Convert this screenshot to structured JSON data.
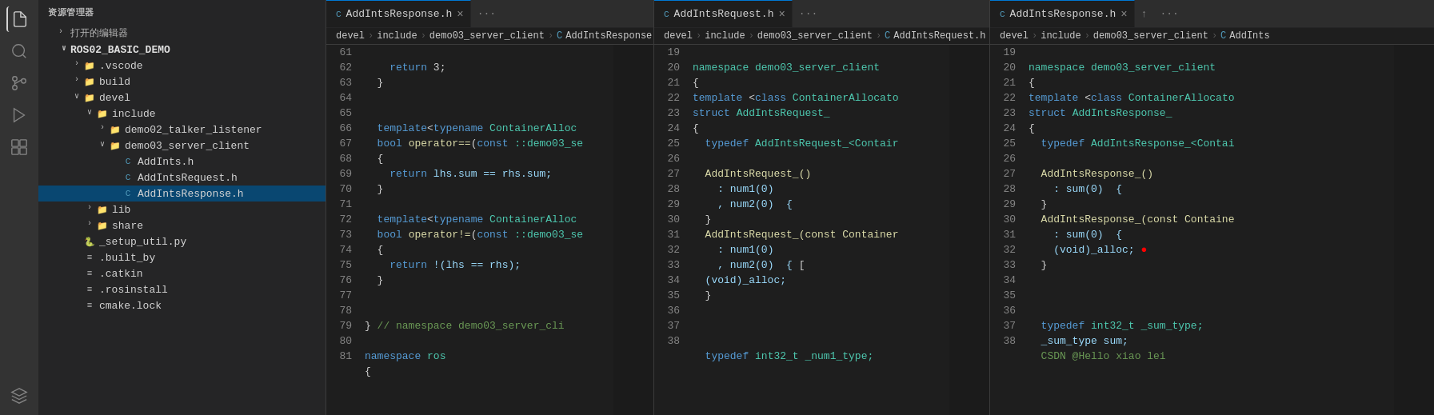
{
  "activityBar": {
    "icons": [
      {
        "name": "files-icon",
        "label": "Explorer",
        "active": true,
        "symbol": "⬜"
      },
      {
        "name": "search-icon",
        "label": "Search",
        "active": false,
        "symbol": "🔍"
      },
      {
        "name": "source-control-icon",
        "label": "Source Control",
        "active": false,
        "symbol": "⎇"
      },
      {
        "name": "run-icon",
        "label": "Run",
        "active": false,
        "symbol": "▷"
      },
      {
        "name": "extensions-icon",
        "label": "Extensions",
        "active": false,
        "symbol": "⊞"
      },
      {
        "name": "remote-icon",
        "label": "Remote",
        "active": false,
        "symbol": "⬡"
      }
    ]
  },
  "sidebar": {
    "header": "资源管理器",
    "openEditors": "打开的编辑器",
    "root": "ROS02_BASIC_DEMO",
    "items": [
      {
        "id": "vscode",
        "label": ".vscode",
        "type": "folder",
        "indent": 2,
        "collapsed": true
      },
      {
        "id": "build",
        "label": "build",
        "type": "folder",
        "indent": 2,
        "collapsed": true
      },
      {
        "id": "devel",
        "label": "devel",
        "type": "folder",
        "indent": 2,
        "collapsed": false
      },
      {
        "id": "include",
        "label": "include",
        "type": "folder",
        "indent": 3,
        "collapsed": false
      },
      {
        "id": "demo02_talker_listener",
        "label": "demo02_talker_listener",
        "type": "folder",
        "indent": 4,
        "collapsed": true
      },
      {
        "id": "demo03_server_client",
        "label": "demo03_server_client",
        "type": "folder",
        "indent": 4,
        "collapsed": false
      },
      {
        "id": "AddInts.h",
        "label": "AddInts.h",
        "type": "c-file",
        "indent": 5
      },
      {
        "id": "AddIntsRequest.h",
        "label": "AddIntsRequest.h",
        "type": "c-file",
        "indent": 5
      },
      {
        "id": "AddIntsResponse.h",
        "label": "AddIntsResponse.h",
        "type": "c-file",
        "indent": 5,
        "selected": true
      },
      {
        "id": "lib",
        "label": "lib",
        "type": "folder",
        "indent": 3,
        "collapsed": true
      },
      {
        "id": "share",
        "label": "share",
        "type": "folder",
        "indent": 3,
        "collapsed": true
      },
      {
        "id": "_setup_util.py",
        "label": "_setup_util.py",
        "type": "py-file",
        "indent": 2
      },
      {
        "id": ".built_by",
        "label": ".built_by",
        "type": "txt-file",
        "indent": 2
      },
      {
        "id": ".catkin",
        "label": ".catkin",
        "type": "txt-file",
        "indent": 2
      },
      {
        "id": ".rosinstall",
        "label": ".rosinstall",
        "type": "txt-file",
        "indent": 2
      },
      {
        "id": "cmake.lock",
        "label": "cmake.lock",
        "type": "txt-file",
        "indent": 2
      }
    ]
  },
  "panes": [
    {
      "id": "pane1",
      "tabs": [
        {
          "label": "AddIntsResponse.h",
          "active": true,
          "icon": "C",
          "hasClose": true
        },
        {
          "label": "...",
          "isMore": true
        }
      ],
      "breadcrumb": [
        "devel",
        ">",
        "include",
        ">",
        "demo03_server_client",
        ">",
        "C",
        "AddIntsResponse"
      ],
      "startLine": 61,
      "lines": [
        {
          "num": 61,
          "tokens": [
            {
              "t": "    ",
              "c": ""
            },
            {
              "t": "return",
              "c": "kw"
            },
            {
              "t": " 3;",
              "c": ""
            }
          ]
        },
        {
          "num": 62,
          "tokens": [
            {
              "t": "  }",
              "c": ""
            }
          ]
        },
        {
          "num": 63,
          "tokens": []
        },
        {
          "num": 64,
          "tokens": []
        },
        {
          "num": 65,
          "tokens": [
            {
              "t": "  ",
              "c": ""
            },
            {
              "t": "template",
              "c": "kw"
            },
            {
              "t": "<",
              "c": ""
            },
            {
              "t": "typename",
              "c": "kw"
            },
            {
              "t": " ContainerAlloc",
              "c": "type"
            }
          ]
        },
        {
          "num": 66,
          "tokens": [
            {
              "t": "  ",
              "c": ""
            },
            {
              "t": "bool",
              "c": "kw"
            },
            {
              "t": " ",
              "c": ""
            },
            {
              "t": "operator==",
              "c": "fn"
            },
            {
              "t": "(",
              "c": ""
            },
            {
              "t": "const",
              "c": "kw"
            },
            {
              "t": " ::demo03_s",
              "c": "ns"
            }
          ]
        },
        {
          "num": 67,
          "tokens": [
            {
              "t": "  {",
              "c": ""
            }
          ]
        },
        {
          "num": 68,
          "tokens": [
            {
              "t": "    ",
              "c": ""
            },
            {
              "t": "return",
              "c": "kw"
            },
            {
              "t": " lhs.sum == rhs.sum;",
              "c": "var"
            }
          ]
        },
        {
          "num": 69,
          "tokens": [
            {
              "t": "  }",
              "c": ""
            }
          ]
        },
        {
          "num": 70,
          "tokens": []
        },
        {
          "num": 71,
          "tokens": [
            {
              "t": "  ",
              "c": ""
            },
            {
              "t": "template",
              "c": "kw"
            },
            {
              "t": "<",
              "c": ""
            },
            {
              "t": "typename",
              "c": "kw"
            },
            {
              "t": " ContainerAlloc",
              "c": "type"
            }
          ]
        },
        {
          "num": 72,
          "tokens": [
            {
              "t": "  ",
              "c": ""
            },
            {
              "t": "bool",
              "c": "kw"
            },
            {
              "t": " ",
              "c": ""
            },
            {
              "t": "operator!=",
              "c": "fn"
            },
            {
              "t": "(",
              "c": ""
            },
            {
              "t": "const",
              "c": "kw"
            },
            {
              "t": " ::demo03_s",
              "c": "ns"
            }
          ]
        },
        {
          "num": 73,
          "tokens": [
            {
              "t": "  {",
              "c": ""
            }
          ]
        },
        {
          "num": 74,
          "tokens": [
            {
              "t": "    ",
              "c": ""
            },
            {
              "t": "return",
              "c": "kw"
            },
            {
              "t": " !(lhs == rhs);",
              "c": "var"
            }
          ]
        },
        {
          "num": 75,
          "tokens": [
            {
              "t": "  }",
              "c": ""
            }
          ]
        },
        {
          "num": 76,
          "tokens": []
        },
        {
          "num": 77,
          "tokens": []
        },
        {
          "num": 78,
          "tokens": [
            {
              "t": "} ",
              "c": ""
            },
            {
              "t": "// namespace demo03_server_cli",
              "c": "cmt"
            }
          ]
        },
        {
          "num": 79,
          "tokens": []
        },
        {
          "num": 80,
          "tokens": [
            {
              "t": "namespace",
              "c": "kw"
            },
            {
              "t": " ros",
              "c": "ns"
            }
          ]
        },
        {
          "num": 81,
          "tokens": [
            {
              "t": "{",
              "c": ""
            }
          ]
        }
      ]
    },
    {
      "id": "pane2",
      "tabs": [
        {
          "label": "AddIntsRequest.h",
          "active": true,
          "icon": "C",
          "hasClose": true
        },
        {
          "label": "...",
          "isMore": true
        }
      ],
      "breadcrumb": [
        "devel",
        ">",
        "include",
        ">",
        "demo03_server_client",
        ">",
        "C",
        "AddIntsRequest.h"
      ],
      "startLine": 19,
      "lines": [
        {
          "num": 19,
          "tokens": [
            {
              "t": "namespace demo03_server_client",
              "c": "ns"
            }
          ]
        },
        {
          "num": 20,
          "tokens": [
            {
              "t": "{",
              "c": ""
            }
          ]
        },
        {
          "num": 21,
          "tokens": [
            {
              "t": "template",
              "c": "kw"
            },
            {
              "t": " <",
              "c": ""
            },
            {
              "t": "class",
              "c": "kw"
            },
            {
              "t": " ContainerAllocato",
              "c": "type"
            }
          ]
        },
        {
          "num": 22,
          "tokens": [
            {
              "t": "struct",
              "c": "kw"
            },
            {
              "t": " AddIntsRequest_",
              "c": "type"
            }
          ]
        },
        {
          "num": 23,
          "tokens": [
            {
              "t": "{",
              "c": ""
            }
          ]
        },
        {
          "num": 24,
          "tokens": [
            {
              "t": "  ",
              "c": ""
            },
            {
              "t": "typedef",
              "c": "kw"
            },
            {
              "t": " AddIntsRequest_<Contair",
              "c": "type"
            }
          ]
        },
        {
          "num": 25,
          "tokens": []
        },
        {
          "num": 26,
          "tokens": [
            {
              "t": "  AddIntsRequest_()",
              "c": "fn"
            }
          ]
        },
        {
          "num": 27,
          "tokens": [
            {
              "t": "    : num1(0)",
              "c": "var"
            }
          ]
        },
        {
          "num": 28,
          "tokens": [
            {
              "t": "    , num2(0)  {",
              "c": "var"
            }
          ]
        },
        {
          "num": 29,
          "tokens": [
            {
              "t": "  }",
              "c": ""
            }
          ]
        },
        {
          "num": 30,
          "tokens": [
            {
              "t": "  AddIntsRequest_(const Container",
              "c": "fn"
            }
          ]
        },
        {
          "num": 31,
          "tokens": [
            {
              "t": "    : num1(0)",
              "c": "var"
            }
          ]
        },
        {
          "num": 32,
          "tokens": [
            {
              "t": "    , num2(0)  {",
              "c": "var"
            },
            {
              "t": " [",
              "c": ""
            }
          ]
        },
        {
          "num": 33,
          "tokens": [
            {
              "t": "  (void)_alloc;",
              "c": "var"
            }
          ]
        },
        {
          "num": 34,
          "tokens": [
            {
              "t": "  }",
              "c": ""
            }
          ]
        },
        {
          "num": 35,
          "tokens": []
        },
        {
          "num": 36,
          "tokens": []
        },
        {
          "num": 37,
          "tokens": []
        },
        {
          "num": 38,
          "tokens": [
            {
              "t": "  ",
              "c": ""
            },
            {
              "t": "typedef",
              "c": "kw"
            },
            {
              "t": " int32_t _num1_type;",
              "c": "type"
            }
          ]
        }
      ]
    },
    {
      "id": "pane3",
      "tabs": [
        {
          "label": "AddIntsResponse.h",
          "active": true,
          "icon": "C",
          "hasClose": true
        },
        {
          "label": "↑",
          "isAction": true
        },
        {
          "label": "...",
          "isMore": true
        }
      ],
      "breadcrumb": [
        "devel",
        ">",
        "include",
        ">",
        "demo03_server_client",
        ">",
        "C",
        "AddInts"
      ],
      "startLine": 19,
      "lines": [
        {
          "num": 19,
          "tokens": [
            {
              "t": "namespace demo03_server_client",
              "c": "ns"
            }
          ]
        },
        {
          "num": 20,
          "tokens": [
            {
              "t": "{",
              "c": ""
            }
          ]
        },
        {
          "num": 21,
          "tokens": [
            {
              "t": "template",
              "c": "kw"
            },
            {
              "t": " <",
              "c": ""
            },
            {
              "t": "class",
              "c": "kw"
            },
            {
              "t": " ContainerAllocato",
              "c": "type"
            }
          ]
        },
        {
          "num": 22,
          "tokens": [
            {
              "t": "struct",
              "c": "kw"
            },
            {
              "t": " AddIntsResponse_",
              "c": "type"
            }
          ]
        },
        {
          "num": 23,
          "tokens": [
            {
              "t": "{",
              "c": ""
            }
          ]
        },
        {
          "num": 24,
          "tokens": [
            {
              "t": "  ",
              "c": ""
            },
            {
              "t": "typedef",
              "c": "kw"
            },
            {
              "t": " AddIntsResponse_<Contai",
              "c": "type"
            }
          ]
        },
        {
          "num": 25,
          "tokens": []
        },
        {
          "num": 26,
          "tokens": [
            {
              "t": "  AddIntsResponse_()",
              "c": "fn"
            }
          ]
        },
        {
          "num": 27,
          "tokens": [
            {
              "t": "    : sum(0)  {",
              "c": "var"
            }
          ]
        },
        {
          "num": 28,
          "tokens": [
            {
              "t": "  }",
              "c": ""
            }
          ]
        },
        {
          "num": 29,
          "tokens": [
            {
              "t": "  AddIntsResponse_(const Containe",
              "c": "fn"
            }
          ]
        },
        {
          "num": 30,
          "tokens": [
            {
              "t": "    : sum(0)  {",
              "c": "var"
            }
          ]
        },
        {
          "num": 31,
          "tokens": [
            {
              "t": "    (void)_alloc;",
              "c": "var"
            },
            {
              "t": "  ●",
              "c": "error"
            }
          ]
        },
        {
          "num": 32,
          "tokens": [
            {
              "t": "  }",
              "c": ""
            }
          ]
        },
        {
          "num": 33,
          "tokens": []
        },
        {
          "num": 34,
          "tokens": []
        },
        {
          "num": 35,
          "tokens": []
        },
        {
          "num": 36,
          "tokens": [
            {
              "t": "  ",
              "c": ""
            },
            {
              "t": "typedef",
              "c": "kw"
            },
            {
              "t": " int32_t _sum_type;",
              "c": "type"
            }
          ]
        },
        {
          "num": 37,
          "tokens": [
            {
              "t": "  _sum_type sum;",
              "c": "var"
            }
          ]
        },
        {
          "num": 38,
          "tokens": [
            {
              "t": "  CSDN @Hello xiao lei",
              "c": "cmt"
            }
          ]
        }
      ]
    }
  ]
}
